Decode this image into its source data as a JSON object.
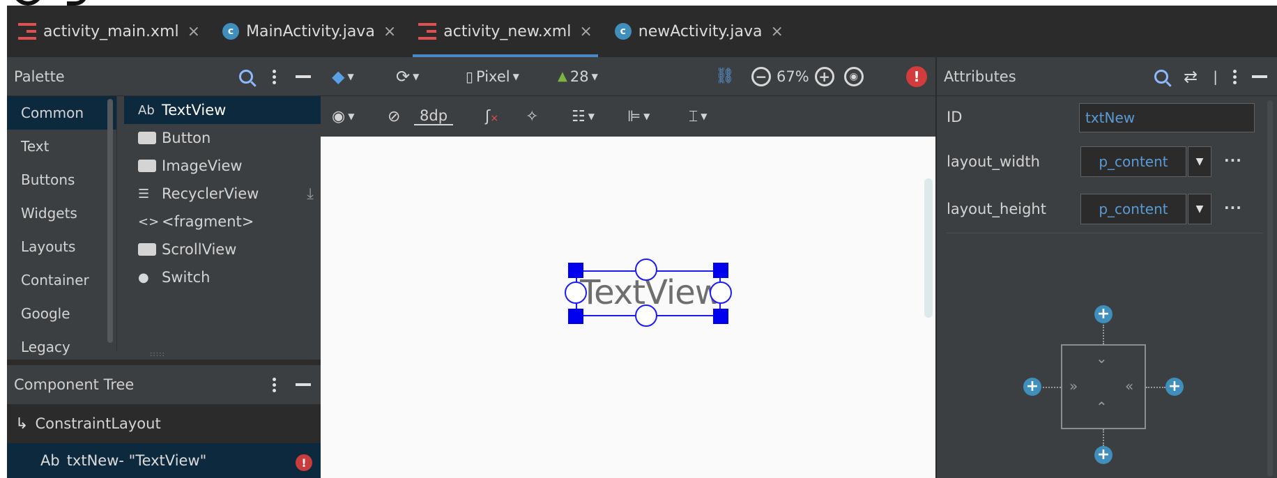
{
  "tabs": [
    {
      "label": "activity_main.xml",
      "kind": "xml",
      "active": false
    },
    {
      "label": "MainActivity.java",
      "kind": "java",
      "active": false
    },
    {
      "label": "activity_new.xml",
      "kind": "xml",
      "active": true
    },
    {
      "label": "newActivity.java",
      "kind": "java",
      "active": false
    }
  ],
  "tab_close": "×",
  "palette": {
    "title": "Palette",
    "categories": [
      "Common",
      "Text",
      "Buttons",
      "Widgets",
      "Layouts",
      "Container",
      "Google",
      "Legacy"
    ],
    "items": [
      {
        "glyph": "Ab",
        "label": "TextView"
      },
      {
        "glyph": "",
        "label": "Button"
      },
      {
        "glyph": "",
        "label": "ImageView"
      },
      {
        "glyph": "☰",
        "label": "RecyclerView"
      },
      {
        "glyph": "<>",
        "label": "<fragment>"
      },
      {
        "glyph": "",
        "label": "ScrollView"
      },
      {
        "glyph": "",
        "label": "Switch"
      }
    ],
    "grip": ":::::"
  },
  "component_tree": {
    "title": "Component Tree",
    "root": "ConstraintLayout",
    "child_glyph": "Ab",
    "child": "txtNew- \"TextView\""
  },
  "toolbar": {
    "device": "Pixel",
    "api": "28",
    "zoom": "67%",
    "margin": "8dp"
  },
  "canvas": {
    "widget_text": "TextView"
  },
  "attributes": {
    "title": "Attributes",
    "id_label": "ID",
    "id_value": "txtNew",
    "layout_width_label": "layout_width",
    "layout_width_value": "p_content",
    "layout_height_label": "layout_height",
    "layout_height_value": "p_content",
    "more": "···"
  },
  "colors": {
    "accent": "#4a88c7",
    "error": "#d33c3c",
    "selection": "#0000ee",
    "panel": "#3c3f41"
  }
}
